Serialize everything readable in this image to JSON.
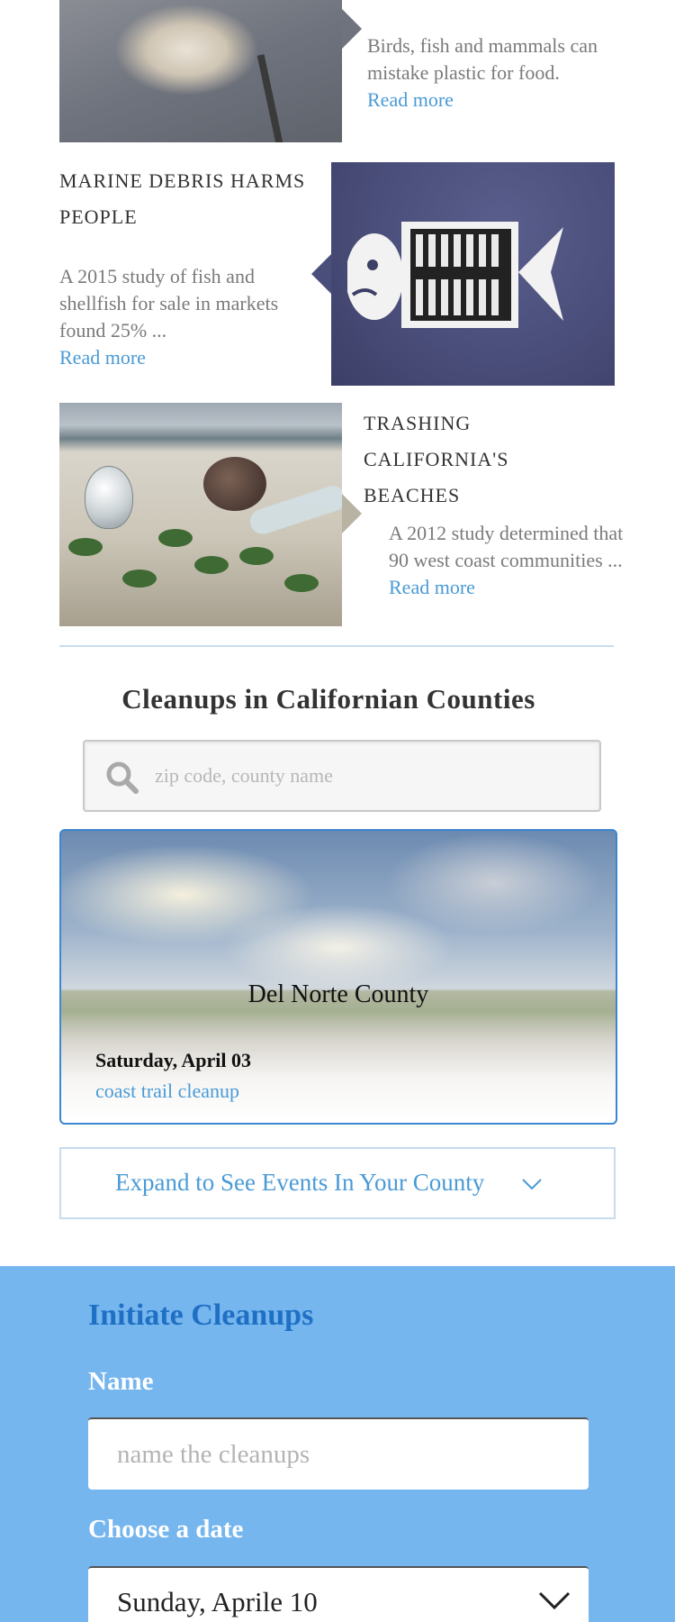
{
  "articles": [
    {
      "title": "",
      "text": "Birds, fish and mammals can mistake plastic for food.",
      "read_more": "Read more"
    },
    {
      "title": "MARINE DEBRIS HARMS PEOPLE",
      "text": " A 2015 study of fish and shellfish for sale in markets found 25% ...",
      "read_more": "Read more"
    },
    {
      "title": "TRASHING CALIFORNIA'S BEACHES",
      "text": "A 2012 study determined that 90 west coast communities ...",
      "read_more": "Read more"
    }
  ],
  "cleanups": {
    "title": "Cleanups in Californian Counties",
    "search_placeholder": "zip code, county name",
    "card": {
      "county": "Del Norte County",
      "date": "Saturday, April 03",
      "event": "coast trail cleanup"
    },
    "expand_label": "Expand to See Events In Your County"
  },
  "form": {
    "title": "Initiate Cleanups",
    "name_label": "Name",
    "name_placeholder": "name the cleanups",
    "date_label": "Choose a date",
    "date_value": "Sunday, Aprile 10"
  },
  "colors": {
    "accent": "#4a9ad6",
    "form_bg": "#76b6ee",
    "form_title": "#1f70c4",
    "card_border": "#3b87d1",
    "divider": "#c7dcef"
  }
}
